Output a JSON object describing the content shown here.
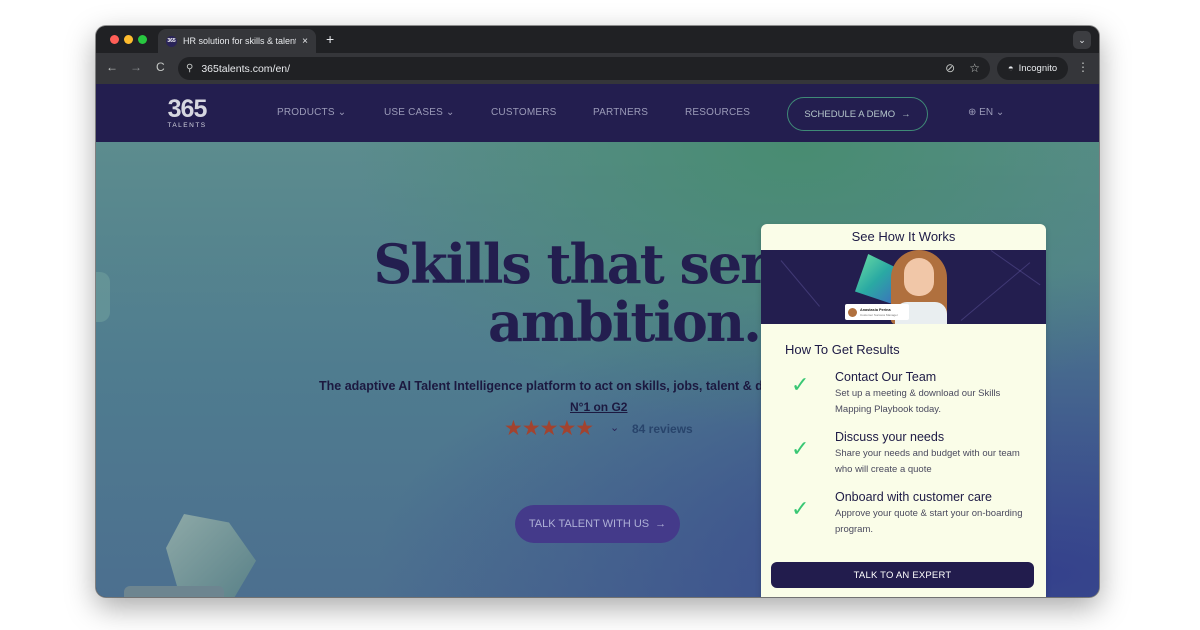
{
  "browser": {
    "tab_title": "HR solution for skills & talent",
    "favicon_text": "365",
    "tab_close": "×",
    "new_tab": "+",
    "url": "365talents.com/en/",
    "incognito_label": "Incognito",
    "back_icon": "←",
    "forward_icon": "→",
    "reload_icon": "C",
    "menu_icon": "⋮"
  },
  "site_nav": {
    "logo_number": "365",
    "logo_text": "TALENTS",
    "items": [
      {
        "label": "PRODUCTS",
        "has_dropdown": true
      },
      {
        "label": "USE CASES",
        "has_dropdown": true
      },
      {
        "label": "CUSTOMERS",
        "has_dropdown": false
      },
      {
        "label": "PARTNERS",
        "has_dropdown": false
      },
      {
        "label": "RESOURCES",
        "has_dropdown": false
      }
    ],
    "demo_button": "SCHEDULE A DEMO",
    "language": "EN"
  },
  "hero": {
    "headline_line1": "Skills that serve y",
    "headline_line2": "ambition.",
    "subline": "The adaptive AI Talent Intelligence platform to act on skills, jobs, talent & deliver",
    "g2_label": "N°1 on G2",
    "stars": "★★★★★",
    "reviews": "84 reviews",
    "cta": "TALK TALENT WITH US"
  },
  "popup": {
    "title": "See How It Works",
    "video_person_name": "Anastasia Perina",
    "video_person_role": "Customer Success Manager",
    "results_title": "How To Get Results",
    "steps": [
      {
        "title": "Contact Our Team",
        "desc": "Set up a meeting & download our Skills Mapping Playbook today."
      },
      {
        "title": "Discuss your needs",
        "desc": "Share your needs and budget with our team who will create a quote"
      },
      {
        "title": "Onboard with customer care",
        "desc": "Approve your quote & start your on-boarding program."
      }
    ],
    "button": "TALK TO AN EXPERT"
  },
  "colors": {
    "nav_bg": "#231e4f",
    "headline": "#231e4f",
    "check": "#39c774",
    "popup_bg": "#fafde8",
    "stars": "#a2432f"
  }
}
